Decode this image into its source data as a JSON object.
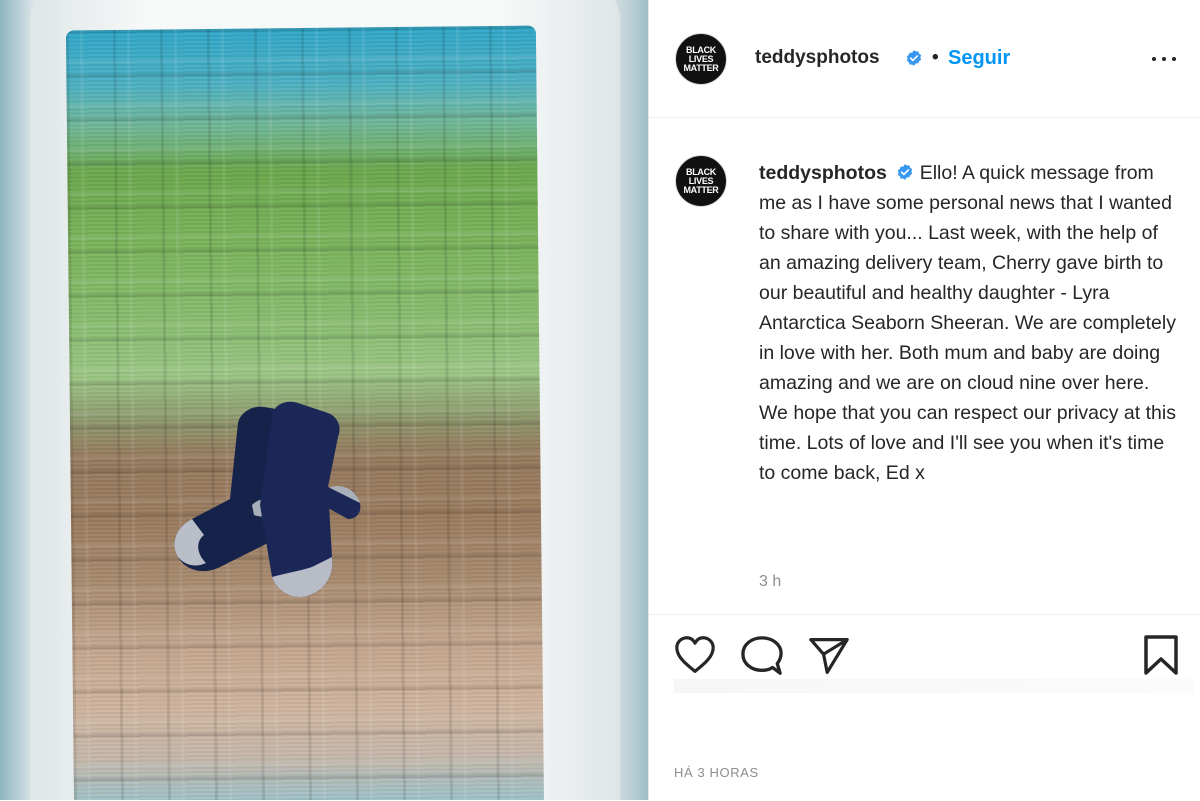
{
  "post": {
    "image_alt": "Knitted gradient blanket with a pair of navy baby socks",
    "colors": {
      "accent_blue": "#0095f6",
      "text_primary": "#262626",
      "text_secondary": "#8e8e8e",
      "verified_badge": "#3897f0"
    }
  },
  "header": {
    "avatar_lines": [
      "BLACK",
      "LIVES",
      "MATTER"
    ],
    "username": "teddysphotos",
    "verified_icon": "verified-badge-icon",
    "separator": "•",
    "follow_label": "Seguir",
    "more_icon": "more-options-icon"
  },
  "caption": {
    "avatar_lines": [
      "BLACK",
      "LIVES",
      "MATTER"
    ],
    "username": "teddysphotos",
    "text": "Ello! A quick message from me as I have some personal news that I wanted to share with you... Last week, with the help of an amazing delivery team, Cherry gave birth to our beautiful and healthy daughter - Lyra Antarctica Seaborn Sheeran. We are completely in love with her. Both mum and baby are doing amazing and we are on cloud nine over here. We hope that you can respect our privacy at this time. Lots of love and I'll see you when it's time to come back, Ed x",
    "time_ago": "3 h"
  },
  "actions": {
    "like_icon": "heart-icon",
    "comment_icon": "comment-icon",
    "share_icon": "share-icon",
    "save_icon": "bookmark-icon",
    "date_label": "HÁ 3 HORAS"
  }
}
